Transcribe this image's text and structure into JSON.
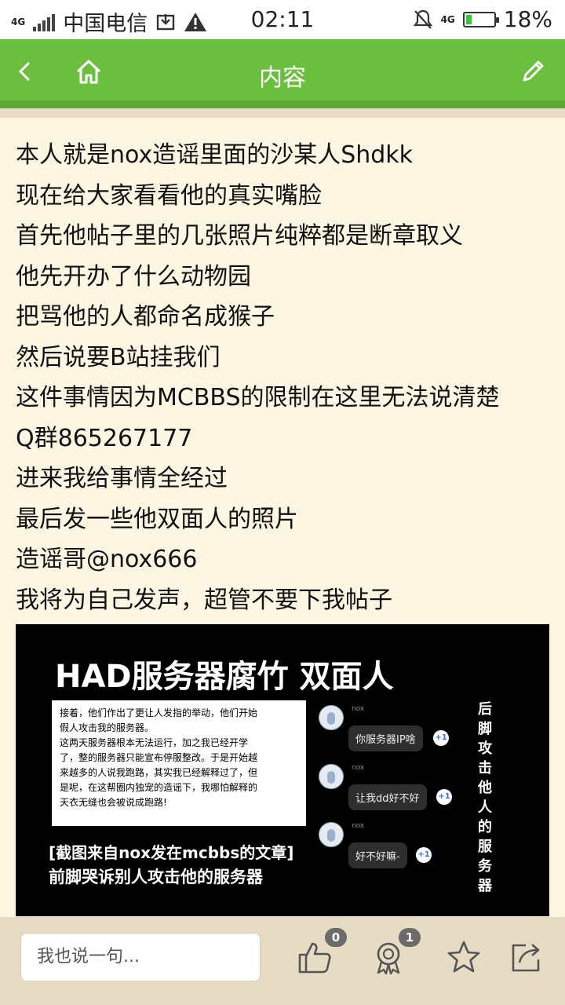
{
  "status_bar": {
    "network_left": "4G",
    "carrier": "中国电信",
    "time": "02:11",
    "network_right": "4G",
    "battery_percent": "18%",
    "battery_level": 0.18
  },
  "header": {
    "title": "内容",
    "back_icon": "chevron-left-icon",
    "home_icon": "home-icon",
    "edit_icon": "pencil-icon",
    "color": "#6cbf3e"
  },
  "post": {
    "lines": [
      "本人就是nox造谣里面的沙某人Shdkk",
      "现在给大家看看他的真实嘴脸",
      "首先他帖子里的几张照片纯粹都是断章取义",
      "他先开办了什么动物园",
      "把骂他的人都命名成猴子",
      "然后说要B站挂我们",
      "这件事情因为MCBBS的限制在这里无法说清楚",
      "Q群865267177",
      "进来我给事情全经过",
      "最后发一些他双面人的照片",
      "造谣哥@nox666",
      "我将为自己发声，超管不要下我帖子"
    ]
  },
  "image": {
    "title": "HAD服务器腐竹  双面人",
    "quote_lines": [
      "接着，他们作出了更让人发指的举动，他们开始",
      "假人攻击我的服务器。",
      "这两天服务器根本无法运行，加之我已经开学",
      "了，整的服务器只能宣布停服整改。于是开始越",
      "来越多的人说我跑路，其实我已经解释过了，但",
      "是呢，在这帮圈内独宠的造谣下，我哪怕解释的",
      "天衣无缝也会被说成跑路!"
    ],
    "caption1": "[截图来自nox发在mcbbs的文章]",
    "caption2": "前脚哭诉别人攻击他的服务器",
    "side_text": "后脚攻击他人的服务器",
    "chats": [
      {
        "user": "nox",
        "message": "你服务器IP啥",
        "plus": "+1"
      },
      {
        "user": "nox",
        "message": "让我dd好不好",
        "plus": "+1"
      },
      {
        "user": "nox",
        "message": "好不好嘛-",
        "plus": "+1"
      }
    ]
  },
  "bottom_bar": {
    "reply_placeholder": "我也说一句...",
    "like_count": "0",
    "award_count": "1",
    "like_icon": "thumbs-up-icon",
    "award_icon": "medal-icon",
    "favorite_icon": "star-icon",
    "share_icon": "share-icon"
  }
}
